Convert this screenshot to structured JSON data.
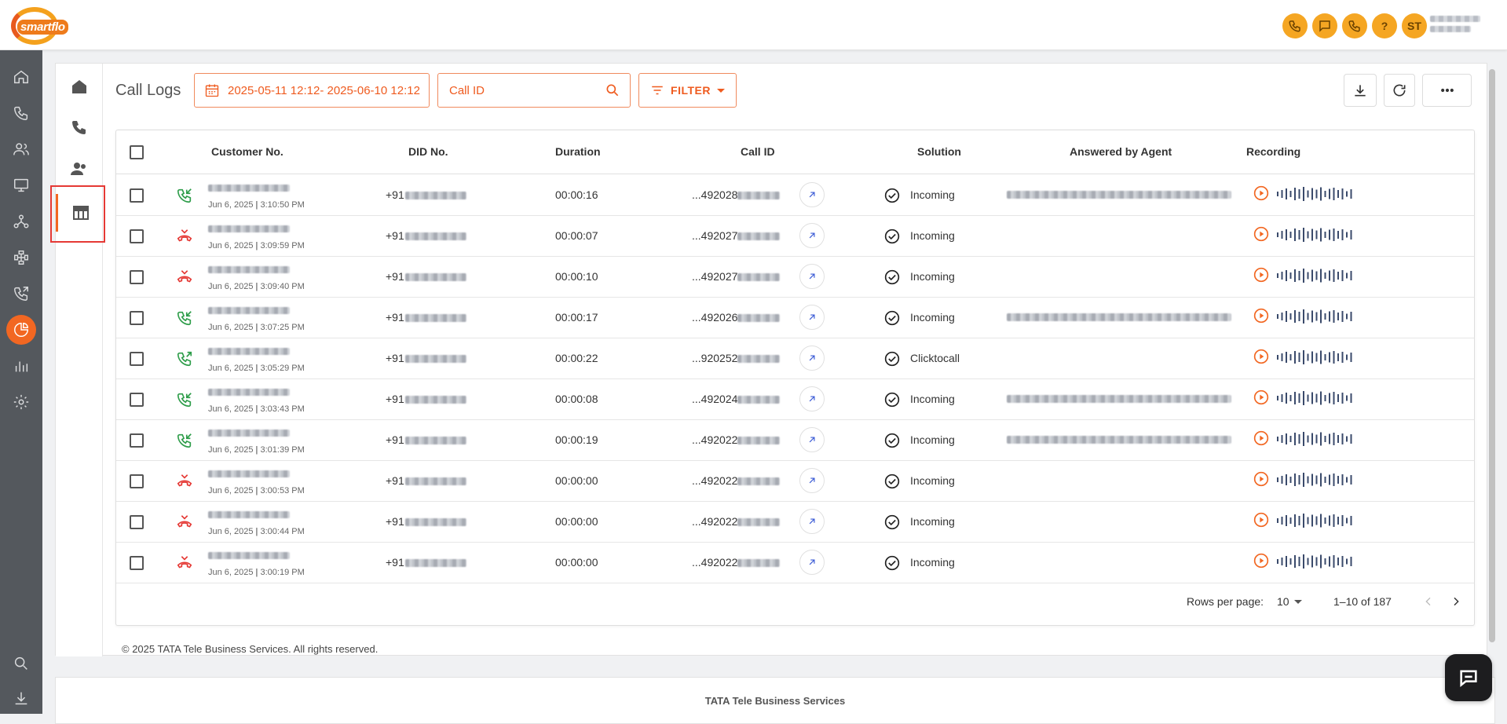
{
  "app": {
    "logo_text": "smartflo",
    "user_initials": "ST"
  },
  "page": {
    "title": "Call Logs",
    "date_range": "2025-05-11 12:12- 2025-06-10 12:12",
    "call_id_placeholder": "Call ID",
    "filter_label": "FILTER"
  },
  "table": {
    "headers": {
      "customer": "Customer No.",
      "did": "DID No.",
      "duration": "Duration",
      "call_id": "Call ID",
      "solution": "Solution",
      "agent": "Answered by Agent",
      "recording": "Recording"
    },
    "rows": [
      {
        "direction": "incoming",
        "date": "Jun 6, 2025",
        "time": "3:10:50 PM",
        "did_prefix": "+91",
        "duration": "00:00:16",
        "call_id": "...492028",
        "solution": "Incoming",
        "agent_blurred": true
      },
      {
        "direction": "missed",
        "date": "Jun 6, 2025",
        "time": "3:09:59 PM",
        "did_prefix": "+91",
        "duration": "00:00:07",
        "call_id": "...492027",
        "solution": "Incoming",
        "agent_blurred": false
      },
      {
        "direction": "missed",
        "date": "Jun 6, 2025",
        "time": "3:09:40 PM",
        "did_prefix": "+91",
        "duration": "00:00:10",
        "call_id": "...492027",
        "solution": "Incoming",
        "agent_blurred": false
      },
      {
        "direction": "incoming",
        "date": "Jun 6, 2025",
        "time": "3:07:25 PM",
        "did_prefix": "+91",
        "duration": "00:00:17",
        "call_id": "...492026",
        "solution": "Incoming",
        "agent_blurred": true
      },
      {
        "direction": "outgoing",
        "date": "Jun 6, 2025",
        "time": "3:05:29 PM",
        "did_prefix": "+91",
        "duration": "00:00:22",
        "call_id": "...920252",
        "solution": "Clicktocall",
        "agent_blurred": false
      },
      {
        "direction": "incoming",
        "date": "Jun 6, 2025",
        "time": "3:03:43 PM",
        "did_prefix": "+91",
        "duration": "00:00:08",
        "call_id": "...492024",
        "solution": "Incoming",
        "agent_blurred": true
      },
      {
        "direction": "incoming",
        "date": "Jun 6, 2025",
        "time": "3:01:39 PM",
        "did_prefix": "+91",
        "duration": "00:00:19",
        "call_id": "...492022",
        "solution": "Incoming",
        "agent_blurred": true
      },
      {
        "direction": "missed",
        "date": "Jun 6, 2025",
        "time": "3:00:53 PM",
        "did_prefix": "+91",
        "duration": "00:00:00",
        "call_id": "...492022",
        "solution": "Incoming",
        "agent_blurred": false
      },
      {
        "direction": "missed",
        "date": "Jun 6, 2025",
        "time": "3:00:44 PM",
        "did_prefix": "+91",
        "duration": "00:00:00",
        "call_id": "...492022",
        "solution": "Incoming",
        "agent_blurred": false
      },
      {
        "direction": "missed",
        "date": "Jun 6, 2025",
        "time": "3:00:19 PM",
        "did_prefix": "+91",
        "duration": "00:00:00",
        "call_id": "...492022",
        "solution": "Incoming",
        "agent_blurred": false
      }
    ]
  },
  "pagination": {
    "rows_per_page_label": "Rows per page:",
    "rows_per_page": "10",
    "range": "1–10 of 187"
  },
  "footer": {
    "copyright": "© 2025 TATA Tele Business Services. All rights reserved.",
    "company": "TATA Tele Business Services"
  },
  "colors": {
    "accent": "#f26722",
    "header_button": "#f5a623",
    "incoming": "#2e9d4a",
    "missed": "#e53935"
  }
}
